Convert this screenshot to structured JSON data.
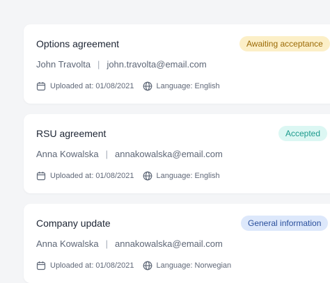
{
  "documents": [
    {
      "title": "Options agreement",
      "status": {
        "label": "Awaiting acceptance",
        "type": "warning"
      },
      "person": {
        "name": "John Travolta",
        "email": "john.travolta@email.com"
      },
      "uploaded": "Uploaded at: 01/08/2021",
      "language": "Language: English"
    },
    {
      "title": "RSU agreement",
      "status": {
        "label": "Accepted",
        "type": "success"
      },
      "person": {
        "name": "Anna Kowalska",
        "email": "annakowalska@email.com"
      },
      "uploaded": "Uploaded at: 01/08/2021",
      "language": "Language: English"
    },
    {
      "title": "Company update",
      "status": {
        "label": "General information",
        "type": "info"
      },
      "person": {
        "name": "Anna Kowalska",
        "email": "annakowalska@email.com"
      },
      "uploaded": "Uploaded at: 01/08/2021",
      "language": "Language: Norwegian"
    }
  ],
  "icons": {
    "uploaded": "calendar-icon",
    "language": "globe-icon"
  },
  "colors": {
    "background": "#f4f5f7",
    "card": "#ffffff",
    "warning_badge_bg": "#fcefc7",
    "success_badge_bg": "#dcf7f3",
    "info_badge_bg": "#dde8fb"
  }
}
